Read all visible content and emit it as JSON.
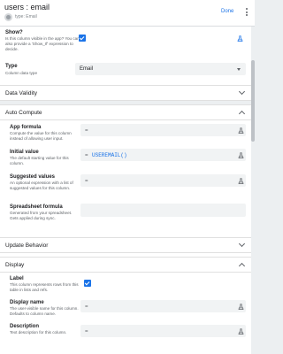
{
  "header": {
    "title": "users : email",
    "subtitle": "type: Email",
    "done_label": "Done"
  },
  "show": {
    "label": "Show?",
    "desc": "Is this column visible in the app? You can also provide a 'Show_If' expression to decide.",
    "checked": true
  },
  "type": {
    "label": "Type",
    "desc": "Column data type",
    "value": "Email"
  },
  "sections": {
    "data_validity": "Data Validity",
    "auto_compute": "Auto Compute",
    "update_behavior": "Update Behavior",
    "display": "Display"
  },
  "auto_compute": {
    "app_formula": {
      "label": "App formula",
      "desc": "Compute the value for this column instead of allowing user input.",
      "eq": "="
    },
    "initial_value": {
      "label": "Initial value",
      "desc": "The default starting value for this column.",
      "eq": "=",
      "value": "USEREMAIL()"
    },
    "suggested_values": {
      "label": "Suggested values",
      "desc": "An optional expression with a list of suggested values for this column.",
      "eq": "="
    },
    "spreadsheet_formula": {
      "label": "Spreadsheet formula",
      "desc": "Generated from your spreadsheet. Gets applied during sync."
    }
  },
  "display": {
    "label_field": {
      "label": "Label",
      "desc": "This column represents rows from this table in lists and refs.",
      "checked": true
    },
    "display_name": {
      "label": "Display name",
      "desc": "The user-visible name for this column. Defaults to column name.",
      "eq": "="
    },
    "description": {
      "label": "Description",
      "desc": "Text description for this column.",
      "eq": "="
    }
  },
  "icons": {
    "flask": "flask-icon",
    "avatar": "column-avatar-icon",
    "more": "more-vert-icon"
  }
}
